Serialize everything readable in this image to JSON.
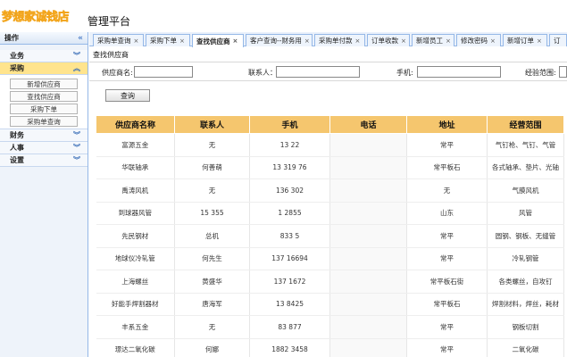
{
  "app": {
    "logo_text": "梦想家诚钱店",
    "platform_title": "管理平台"
  },
  "sidebar": {
    "header": "操作",
    "collapse_icon": "double-chevron-left-icon",
    "groups": [
      {
        "label": "业务",
        "active": false
      },
      {
        "label": "采购",
        "active": true,
        "items": [
          "新增供应商",
          "查找供应商",
          "采购下单",
          "采购单查询"
        ]
      },
      {
        "label": "财务",
        "active": false
      },
      {
        "label": "人事",
        "active": false
      },
      {
        "label": "设置",
        "active": false
      }
    ]
  },
  "tabs": [
    {
      "label": "采购单查询",
      "active": false
    },
    {
      "label": "采购下单",
      "active": false
    },
    {
      "label": "查找供应商",
      "active": true
    },
    {
      "label": "客户查询--财务用",
      "active": false
    },
    {
      "label": "采购单付款",
      "active": false
    },
    {
      "label": "订单收款",
      "active": false
    },
    {
      "label": "新增员工",
      "active": false
    },
    {
      "label": "修改密码",
      "active": false
    },
    {
      "label": "新增订单",
      "active": false
    },
    {
      "label": "订",
      "active": false
    }
  ],
  "content": {
    "breadcrumb": "查找供应商",
    "filters": {
      "supplier_name": {
        "label": "供应商名:",
        "value": ""
      },
      "contact": {
        "label": "联系人：",
        "value": ""
      },
      "mobile": {
        "label": "手机:",
        "value": ""
      },
      "scope": {
        "label": "经验范围:",
        "value": ""
      }
    },
    "query_button": "查询"
  },
  "table": {
    "columns": [
      "供应商名称",
      "联系人",
      "手机",
      "电话",
      "地址",
      "经营范围"
    ],
    "rows": [
      [
        "富源五金",
        "无",
        "13   22",
        "",
        "常平",
        "气钉枪、气钉、气管"
      ],
      [
        "华联轴承",
        "何善萌",
        "13 319 76",
        "",
        "常平板石",
        "各式轴承、垫片、光轴"
      ],
      [
        "禹涛风机",
        "无",
        "136    302",
        "",
        "无",
        "气膜风机"
      ],
      [
        "到球器风管",
        "15  355",
        "1  2855",
        "",
        "山东",
        "风管"
      ],
      [
        "先民钢材",
        "总机",
        "833   5",
        "",
        "常平",
        "圆钢、钢板、无缝管"
      ],
      [
        "地球仪冷轧管",
        "何先生",
        "137  16694",
        "",
        "常平",
        "冷轧钢管"
      ],
      [
        "上海螺丝",
        "黄盛华",
        "137   1672",
        "",
        "常平板石街",
        "各类螺丝，自攻钉"
      ],
      [
        "好能手焊割器材",
        "唐海军",
        "13   8425",
        "",
        "常平板石",
        "焊割材料，焊丝，耗材"
      ],
      [
        "丰系五金",
        "无",
        "83  877",
        "",
        "常平",
        "钢板切割"
      ],
      [
        "璟达二氧化碳",
        "何娜",
        "1882  3458",
        "",
        "常平",
        "二氧化碳"
      ]
    ]
  }
}
